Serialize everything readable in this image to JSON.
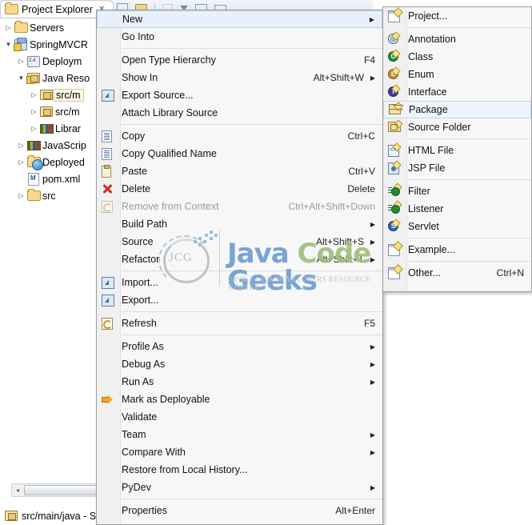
{
  "view": {
    "tab_title": "Project Explorer",
    "close_icon": "close-icon",
    "toolbar_icons": [
      "collapse-all-icon",
      "link-with-editor-icon",
      "separator",
      "minimize-icon",
      "view-menu-icon",
      "minimize-view-icon",
      "maximize-view-icon"
    ],
    "tree": [
      {
        "label": "Servers",
        "indent": 1,
        "arrow": "collapsed",
        "icon": "folder-icon",
        "selected": false
      },
      {
        "label": "SpringMVCR",
        "indent": 1,
        "arrow": "expanded",
        "icon": "project-icon",
        "selected": false
      },
      {
        "label": "Deploym",
        "indent": 2,
        "arrow": "collapsed",
        "icon": "deployment-descriptor-icon",
        "selected": false
      },
      {
        "label": "Java Reso",
        "indent": 2,
        "arrow": "expanded",
        "icon": "java-resources-icon",
        "selected": false
      },
      {
        "label": "src/m",
        "indent": 3,
        "arrow": "collapsed",
        "icon": "source-folder-icon",
        "selected": true
      },
      {
        "label": "src/m",
        "indent": 3,
        "arrow": "collapsed",
        "icon": "source-folder-icon",
        "selected": false
      },
      {
        "label": "Librar",
        "indent": 3,
        "arrow": "collapsed",
        "icon": "libraries-icon",
        "selected": false
      },
      {
        "label": "JavaScrip",
        "indent": 2,
        "arrow": "collapsed",
        "icon": "libraries-icon",
        "selected": false
      },
      {
        "label": "Deployed",
        "indent": 2,
        "arrow": "collapsed",
        "icon": "deployed-resources-icon",
        "selected": false
      },
      {
        "label": "pom.xml",
        "indent": 2,
        "arrow": "none",
        "icon": "maven-pom-icon",
        "selected": false
      },
      {
        "label": "src",
        "indent": 2,
        "arrow": "collapsed",
        "icon": "folder-icon",
        "selected": false
      }
    ],
    "hscrollbar": {
      "left_arrow": "◂",
      "thumb_grip": "|||"
    }
  },
  "statusbar": {
    "icon": "source-folder-icon",
    "text": "src/main/java - Spr"
  },
  "context_menu": {
    "items": [
      {
        "label": "New",
        "accel": "",
        "submenu": true,
        "icon": "",
        "highlighted": true,
        "disabled": false
      },
      {
        "label": "Go Into",
        "accel": "",
        "submenu": false,
        "icon": "",
        "highlighted": false,
        "disabled": false
      },
      {
        "separator": true
      },
      {
        "label": "Open Type Hierarchy",
        "accel": "F4",
        "submenu": false,
        "icon": "",
        "highlighted": false,
        "disabled": false
      },
      {
        "label": "Show In",
        "accel": "Alt+Shift+W",
        "submenu": true,
        "icon": "",
        "highlighted": false,
        "disabled": false
      },
      {
        "label": "Export Source...",
        "accel": "",
        "submenu": false,
        "icon": "export-source-icon",
        "highlighted": false,
        "disabled": false
      },
      {
        "label": "Attach Library Source",
        "accel": "",
        "submenu": false,
        "icon": "",
        "highlighted": false,
        "disabled": false
      },
      {
        "separator": true
      },
      {
        "label": "Copy",
        "accel": "Ctrl+C",
        "submenu": false,
        "icon": "copy-icon",
        "highlighted": false,
        "disabled": false
      },
      {
        "label": "Copy Qualified Name",
        "accel": "",
        "submenu": false,
        "icon": "copy-qualified-icon",
        "highlighted": false,
        "disabled": false
      },
      {
        "label": "Paste",
        "accel": "Ctrl+V",
        "submenu": false,
        "icon": "paste-icon",
        "highlighted": false,
        "disabled": false
      },
      {
        "label": "Delete",
        "accel": "Delete",
        "submenu": false,
        "icon": "delete-icon",
        "highlighted": false,
        "disabled": false
      },
      {
        "label": "Remove from Context",
        "accel": "Ctrl+Alt+Shift+Down",
        "submenu": false,
        "icon": "remove-context-icon",
        "highlighted": false,
        "disabled": true
      },
      {
        "label": "Build Path",
        "accel": "",
        "submenu": true,
        "icon": "",
        "highlighted": false,
        "disabled": false
      },
      {
        "label": "Source",
        "accel": "Alt+Shift+S",
        "submenu": true,
        "icon": "",
        "highlighted": false,
        "disabled": false
      },
      {
        "label": "Refactor",
        "accel": "Alt+Shift+T",
        "submenu": true,
        "icon": "",
        "highlighted": false,
        "disabled": false
      },
      {
        "separator": true
      },
      {
        "label": "Import...",
        "accel": "",
        "submenu": false,
        "icon": "import-icon",
        "highlighted": false,
        "disabled": false
      },
      {
        "label": "Export...",
        "accel": "",
        "submenu": false,
        "icon": "export-icon",
        "highlighted": false,
        "disabled": false
      },
      {
        "separator": true
      },
      {
        "label": "Refresh",
        "accel": "F5",
        "submenu": false,
        "icon": "refresh-icon",
        "highlighted": false,
        "disabled": false
      },
      {
        "separator": true
      },
      {
        "label": "Profile As",
        "accel": "",
        "submenu": true,
        "icon": "",
        "highlighted": false,
        "disabled": false
      },
      {
        "label": "Debug As",
        "accel": "",
        "submenu": true,
        "icon": "",
        "highlighted": false,
        "disabled": false
      },
      {
        "label": "Run As",
        "accel": "",
        "submenu": true,
        "icon": "",
        "highlighted": false,
        "disabled": false
      },
      {
        "label": "Mark as Deployable",
        "accel": "",
        "submenu": false,
        "icon": "deployable-icon",
        "highlighted": false,
        "disabled": false
      },
      {
        "label": "Validate",
        "accel": "",
        "submenu": false,
        "icon": "",
        "highlighted": false,
        "disabled": false
      },
      {
        "label": "Team",
        "accel": "",
        "submenu": true,
        "icon": "",
        "highlighted": false,
        "disabled": false
      },
      {
        "label": "Compare With",
        "accel": "",
        "submenu": true,
        "icon": "",
        "highlighted": false,
        "disabled": false
      },
      {
        "label": "Restore from Local History...",
        "accel": "",
        "submenu": false,
        "icon": "",
        "highlighted": false,
        "disabled": false
      },
      {
        "label": "PyDev",
        "accel": "",
        "submenu": true,
        "icon": "",
        "highlighted": false,
        "disabled": false
      },
      {
        "separator": true
      },
      {
        "label": "Properties",
        "accel": "Alt+Enter",
        "submenu": false,
        "icon": "",
        "highlighted": false,
        "disabled": false
      }
    ]
  },
  "new_submenu": {
    "items": [
      {
        "label": "Project...",
        "accel": "",
        "icon": "new-project-icon",
        "highlighted": false
      },
      {
        "separator": true
      },
      {
        "label": "Annotation",
        "accel": "",
        "icon": "new-annotation-icon",
        "highlighted": false
      },
      {
        "label": "Class",
        "accel": "",
        "icon": "new-class-icon",
        "highlighted": false
      },
      {
        "label": "Enum",
        "accel": "",
        "icon": "new-enum-icon",
        "highlighted": false
      },
      {
        "label": "Interface",
        "accel": "",
        "icon": "new-interface-icon",
        "highlighted": false
      },
      {
        "label": "Package",
        "accel": "",
        "icon": "new-package-icon",
        "highlighted": true
      },
      {
        "label": "Source Folder",
        "accel": "",
        "icon": "new-source-folder-icon",
        "highlighted": false
      },
      {
        "separator": true
      },
      {
        "label": "HTML File",
        "accel": "",
        "icon": "new-html-file-icon",
        "highlighted": false
      },
      {
        "label": "JSP File",
        "accel": "",
        "icon": "new-jsp-file-icon",
        "highlighted": false
      },
      {
        "separator": true
      },
      {
        "label": "Filter",
        "accel": "",
        "icon": "new-filter-icon",
        "highlighted": false
      },
      {
        "label": "Listener",
        "accel": "",
        "icon": "new-listener-icon",
        "highlighted": false
      },
      {
        "label": "Servlet",
        "accel": "",
        "icon": "new-servlet-icon",
        "highlighted": false
      },
      {
        "separator": true
      },
      {
        "label": "Example...",
        "accel": "",
        "icon": "new-example-icon",
        "highlighted": false
      },
      {
        "separator": true
      },
      {
        "label": "Other...",
        "accel": "Ctrl+N",
        "icon": "new-other-icon",
        "highlighted": false
      }
    ]
  },
  "watermark": {
    "logo_text": "JCG",
    "word1": "Java",
    "word2": "Code",
    "word3": "Geeks",
    "tagline": "JAVA 2 JAVA DEVELOPERS RESOURCE CENTER"
  },
  "colors": {
    "menu_bg": "#f7f7f7",
    "menu_gutter": "#f0f0f0",
    "highlight": "#e8f0fa",
    "highlight_border": "#b9cfe8",
    "selection": "#fbf5e3",
    "disabled_text": "#9a9a9a"
  }
}
